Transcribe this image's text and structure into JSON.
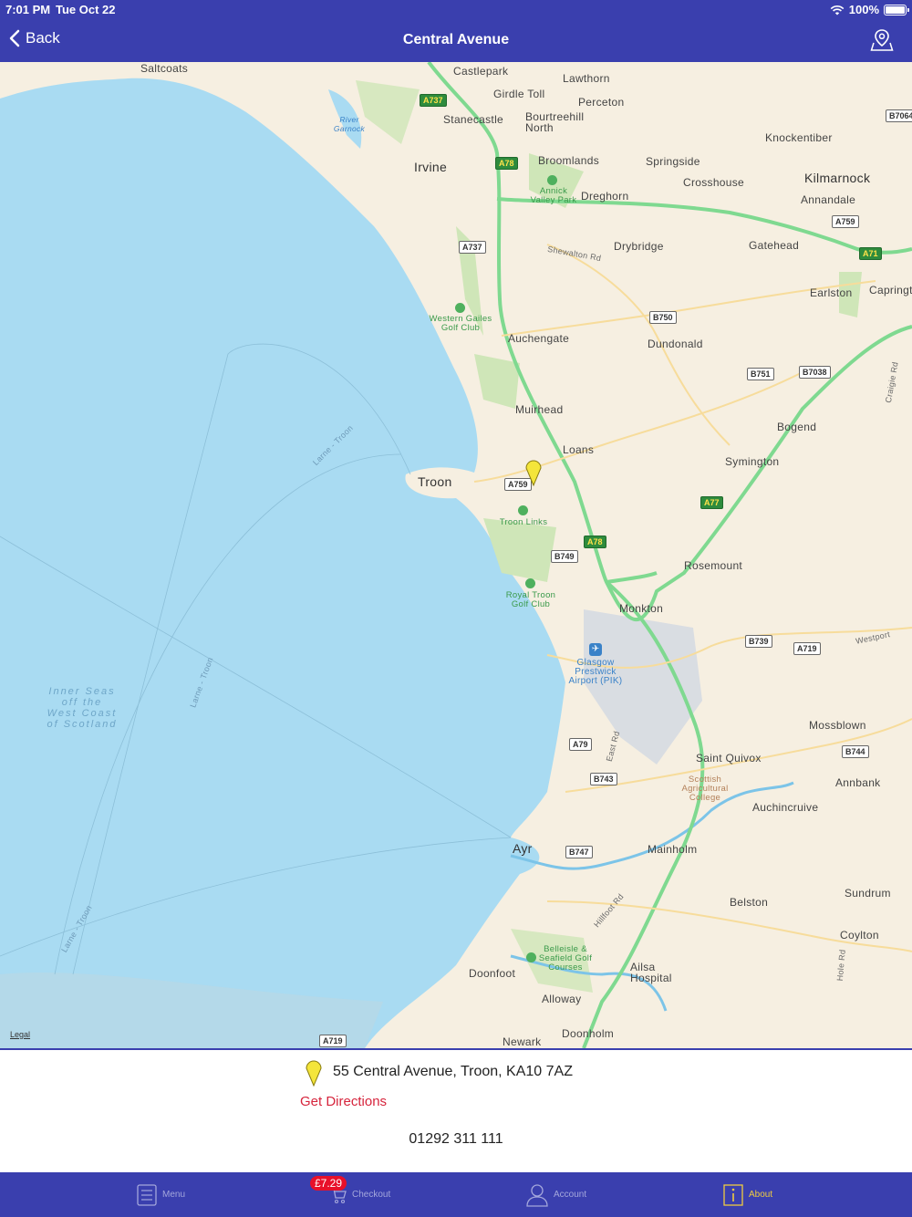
{
  "status_bar": {
    "time": "7:01 PM",
    "date": "Tue Oct 22",
    "battery": "100%"
  },
  "nav": {
    "back_label": "Back",
    "title": "Central Avenue"
  },
  "map": {
    "legal_label": "Legal",
    "places": [
      "Saltcoats",
      "Castlepark",
      "Lawthorn",
      "Girdle Toll",
      "Perceton",
      "Stanecastle",
      "Bourtreehill North",
      "Irvine",
      "Broomlands",
      "Springside",
      "Knockentiber",
      "Kilmarnock",
      "Crosshouse",
      "Annandale",
      "Dreghorn",
      "Drybridge",
      "Gatehead",
      "Earlston",
      "Caprington",
      "Auchengate",
      "Dundonald",
      "Muirhead",
      "Loans",
      "Bogend",
      "Symington",
      "Troon",
      "Rosemount",
      "Monkton",
      "Mossblown",
      "Saint Quivox",
      "Annbank",
      "Auchincruive",
      "Ayr",
      "Mainholm",
      "Sundrum",
      "Belston",
      "Coylton",
      "Doonfoot",
      "Alloway",
      "Newark",
      "Doonholm",
      "Ailsa Hospital"
    ],
    "parks": [
      "River Garnock",
      "Annick Valley Park",
      "Western Gailes Golf Club",
      "Troon Links",
      "Royal Troon Golf Club",
      "Belleisle & Seafield Golf Courses",
      "Scottish Agricultural College"
    ],
    "airport": "Glasgow Prestwick Airport (PIK)",
    "sea_label": "Inner Seas off the West Coast of Scotland",
    "roads": [
      "A737",
      "A78",
      "A71",
      "A759",
      "B7064",
      "B750",
      "B751",
      "B7038",
      "A77",
      "B749",
      "B739",
      "A719",
      "A79",
      "B743",
      "B744",
      "B747"
    ],
    "road_names": [
      "Shewalton Rd",
      "Westport",
      "Craigie Rd",
      "East Rd",
      "Hillfoot Rd",
      "Hole Rd",
      "Larne - Troon"
    ]
  },
  "location": {
    "address": "55 Central Avenue, Troon, KA10 7AZ",
    "directions_label": "Get Directions",
    "phone": "01292 311 111"
  },
  "tabs": [
    {
      "label": "Menu",
      "icon": "menu-list-icon"
    },
    {
      "label": "Checkout",
      "icon": "cart-icon",
      "badge": "£7.29"
    },
    {
      "label": "Account",
      "icon": "person-icon"
    },
    {
      "label": "About",
      "icon": "info-icon",
      "active": true
    }
  ],
  "colors": {
    "brand": "#3a3fae",
    "accent": "#f0cc40",
    "directions": "#d6243c",
    "badge": "#e8102a",
    "sea": "#a9dbf2",
    "land": "#f6efe1"
  }
}
